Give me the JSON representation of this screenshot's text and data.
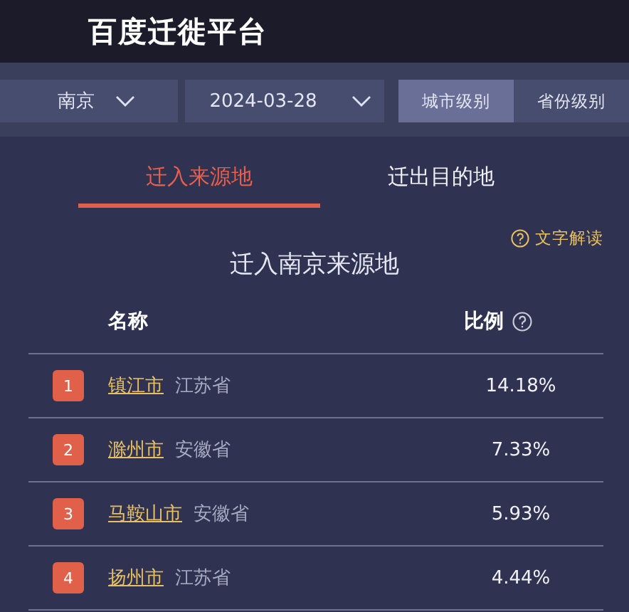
{
  "header": {
    "title": "百度迁徙平台"
  },
  "filters": {
    "city": "南京",
    "date": "2024-03-28",
    "levels": [
      {
        "label": "城市级别",
        "selected": true
      },
      {
        "label": "省份级别",
        "selected": false
      }
    ]
  },
  "tabs": [
    {
      "label": "迁入来源地",
      "selected": true
    },
    {
      "label": "迁出目的地",
      "selected": false
    }
  ],
  "help_link": "文字解读",
  "table": {
    "title": "迁入南京来源地",
    "columns": [
      "名称",
      "比例"
    ],
    "rows": [
      {
        "rank": "1",
        "city": "镇江市",
        "province": "江苏省",
        "ratio": "14.18%"
      },
      {
        "rank": "2",
        "city": "滁州市",
        "province": "安徽省",
        "ratio": "7.33%"
      },
      {
        "rank": "3",
        "city": "马鞍山市",
        "province": "安徽省",
        "ratio": "5.93%"
      },
      {
        "rank": "4",
        "city": "扬州市",
        "province": "江苏省",
        "ratio": "4.44%"
      }
    ]
  }
}
